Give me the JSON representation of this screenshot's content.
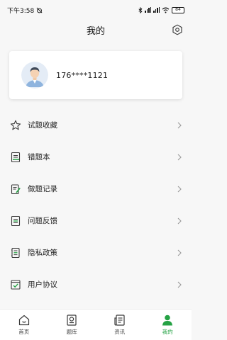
{
  "status_bar": {
    "time": "下午3:58",
    "battery": "84"
  },
  "header": {
    "title": "我的"
  },
  "profile": {
    "phone": "176****1121"
  },
  "menu": {
    "items": [
      {
        "label": "试题收藏",
        "icon": "star-icon"
      },
      {
        "label": "错题本",
        "icon": "notebook-icon"
      },
      {
        "label": "做题记录",
        "icon": "record-icon"
      },
      {
        "label": "问题反馈",
        "icon": "feedback-icon"
      },
      {
        "label": "隐私政策",
        "icon": "privacy-icon"
      },
      {
        "label": "用户协议",
        "icon": "agreement-icon"
      }
    ]
  },
  "tabbar": {
    "items": [
      {
        "label": "首页",
        "icon": "home-icon"
      },
      {
        "label": "题库",
        "icon": "question-bank-icon"
      },
      {
        "label": "资讯",
        "icon": "news-icon"
      },
      {
        "label": "我的",
        "icon": "profile-icon",
        "active": true
      }
    ]
  },
  "colors": {
    "accent": "#25a244",
    "background": "#f7f7f7",
    "icon": "#3a3a3a"
  }
}
